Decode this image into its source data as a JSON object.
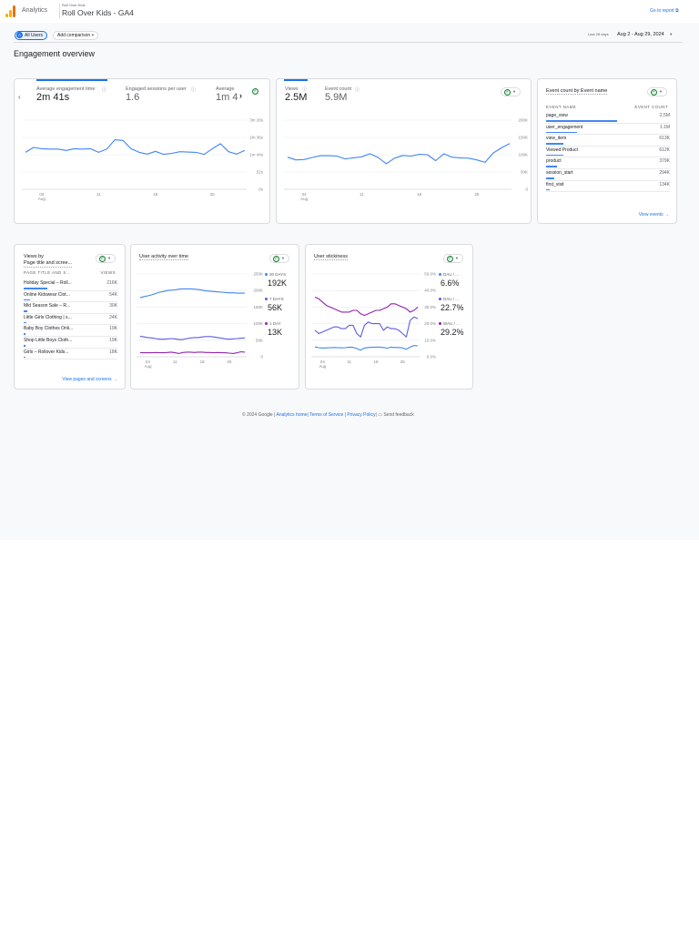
{
  "header": {
    "app_name": "Analytics",
    "account": "Roll Over Kids",
    "property": "Roll Over Kids - GA4",
    "go_to_report": "Go to report"
  },
  "toolbar": {
    "segment_letter": "A",
    "segment": "All Users",
    "add_comparison": "Add comparison",
    "add_icon": "+",
    "date_prefix": "Last 28 days",
    "date_range": "Aug 2 - Aug 29, 2024"
  },
  "page_title": "Engagement overview",
  "card1": {
    "metrics": [
      {
        "label": "Average engagement time",
        "value": "2m 41s"
      },
      {
        "label": "Engaged sessions per user",
        "value": "1.6"
      },
      {
        "label": "Average",
        "value": "1m 4"
      }
    ]
  },
  "card2": {
    "metrics": [
      {
        "label": "Views",
        "value": "2.5M"
      },
      {
        "label": "Event count",
        "value": "5.9M"
      }
    ]
  },
  "card3": {
    "title": "Event count by Event name",
    "col1": "EVENT NAME",
    "col2": "EVENT COUNT",
    "link": "View events",
    "rows": [
      {
        "name": "page_view",
        "value": "2.5M",
        "share": 1.0
      },
      {
        "name": "user_engagement",
        "value": "1.1M",
        "share": 0.44
      },
      {
        "name": "view_item",
        "value": "613K",
        "share": 0.25
      },
      {
        "name": "Viewed Product",
        "value": "612K",
        "share": 0.25
      },
      {
        "name": "product",
        "value": "379K",
        "share": 0.15
      },
      {
        "name": "session_start",
        "value": "294K",
        "share": 0.12
      },
      {
        "name": "first_visit",
        "value": "134K",
        "share": 0.05
      }
    ]
  },
  "card4": {
    "title_line1": "Views by",
    "title_line2": "Page title and scree...",
    "col1": "PAGE TITLE AND S...",
    "col2": "VIEWS",
    "link": "View pages and screens",
    "rows": [
      {
        "name": "Holiday Special – Roll...",
        "value": "216K",
        "share": 0.45
      },
      {
        "name": "Online Kidswear Clot...",
        "value": "54K",
        "share": 0.12
      },
      {
        "name": "Mid Season Sale – R...",
        "value": "30K",
        "share": 0.06
      },
      {
        "name": "Little Girls Clothing | s...",
        "value": "24K",
        "share": 0.05
      },
      {
        "name": "Baby Boy Clothes Onli...",
        "value": "19K",
        "share": 0.04
      },
      {
        "name": "Shop Little Boys Cloth...",
        "value": "19K",
        "share": 0.04
      },
      {
        "name": "Girls – Rollover Kids...",
        "value": "18K",
        "share": 0.04
      }
    ]
  },
  "card5": {
    "title": "User activity over time",
    "legend": [
      {
        "label": "30 DAYS",
        "value": "192K"
      },
      {
        "label": "7 DAYS",
        "value": "56K"
      },
      {
        "label": "1 DAY",
        "value": "13K"
      }
    ]
  },
  "card6": {
    "title": "User stickiness",
    "legend": [
      {
        "label": "DAU / ...",
        "value": "6.6%"
      },
      {
        "label": "DAU / ...",
        "value": "22.7%"
      },
      {
        "label": "WAU / ...",
        "value": "29.2%"
      }
    ]
  },
  "footer": {
    "copyright": "© 2024 Google |",
    "analytics_home": "Analytics home",
    "sep1": "|",
    "terms": "Terms of Service",
    "sep2": "|",
    "privacy": "Privacy Policy",
    "sep3": "|",
    "feedback": "Send feedback"
  },
  "colors": {
    "accent": "#1a73e8",
    "line1": "#4285f4",
    "line2": "#5c5ce6",
    "line3": "#8e24aa"
  },
  "chart_data": [
    {
      "type": "line",
      "title": "Average engagement time",
      "ylim": [
        0,
        208
      ],
      "yticks": [
        "0s",
        "52s",
        "1m 44s",
        "2m 36s",
        "3m 28s"
      ],
      "xticks": [
        "04",
        "11",
        "18",
        "25"
      ],
      "xtick_index": [
        2,
        9,
        16,
        23
      ],
      "xsub": "Aug",
      "series": [
        {
          "name": "Average engagement time (s)",
          "color": "#4285f4",
          "values": [
            111,
            126,
            122,
            121,
            121,
            117,
            122,
            121,
            122,
            111,
            121,
            149,
            147,
            122,
            111,
            106,
            114,
            105,
            108,
            113,
            112,
            111,
            105,
            122,
            137,
            113,
            106,
            117
          ]
        }
      ]
    },
    {
      "type": "line",
      "title": "Views",
      "ylim": [
        0,
        200
      ],
      "yticks": [
        "0",
        "50K",
        "100K",
        "150K",
        "200K"
      ],
      "xticks": [
        "04",
        "11",
        "18",
        "25"
      ],
      "xtick_index": [
        2,
        9,
        16,
        23
      ],
      "xsub": "Aug",
      "series": [
        {
          "name": "Views (K)",
          "color": "#4285f4",
          "values": [
            93,
            85,
            86,
            92,
            97,
            97,
            96,
            88,
            91,
            94,
            103,
            92,
            74,
            90,
            98,
            96,
            101,
            100,
            83,
            103,
            93,
            91,
            90,
            85,
            78,
            105,
            120,
            132
          ]
        }
      ]
    },
    {
      "type": "line",
      "title": "User activity over time",
      "ylim": [
        0,
        250
      ],
      "yticks": [
        "0",
        "50K",
        "100K",
        "150K",
        "200K",
        "250K"
      ],
      "xticks": [
        "04",
        "11",
        "18",
        "25"
      ],
      "xtick_index": [
        2,
        9,
        16,
        23
      ],
      "xsub": "Aug",
      "series": [
        {
          "name": "30 days (K)",
          "color": "#4285f4",
          "values": [
            178,
            182,
            184,
            187,
            191,
            195,
            197,
            200,
            201,
            202,
            204,
            205,
            205,
            205,
            204,
            203,
            201,
            199,
            198,
            197,
            196,
            195,
            194,
            193,
            193,
            192,
            192,
            192
          ]
        },
        {
          "name": "7 days (K)",
          "color": "#5c5ce6",
          "values": [
            62,
            60,
            58,
            57,
            55,
            53,
            53,
            54,
            55,
            54,
            52,
            52,
            55,
            57,
            58,
            58,
            60,
            61,
            61,
            60,
            58,
            56,
            54,
            53,
            54,
            55,
            56,
            57
          ]
        },
        {
          "name": "1 day (K)",
          "color": "#8e24aa",
          "values": [
            12,
            12,
            12,
            12,
            13,
            12,
            12,
            13,
            14,
            12,
            10,
            13,
            14,
            14,
            13,
            14,
            14,
            13,
            13,
            12,
            13,
            12,
            12,
            11,
            10,
            12,
            15,
            14
          ]
        }
      ]
    },
    {
      "type": "line",
      "title": "User stickiness",
      "ylim": [
        0,
        50
      ],
      "yticks": [
        "0.0%",
        "10.0%",
        "20.0%",
        "30.0%",
        "40.0%",
        "50.0%"
      ],
      "xticks": [
        "04",
        "11",
        "18",
        "25"
      ],
      "xtick_index": [
        2,
        9,
        16,
        23
      ],
      "xsub": "Aug",
      "series": [
        {
          "name": "WAU / MAU",
          "color": "#8e24aa",
          "values": [
            36,
            35,
            33,
            31,
            30,
            29,
            28,
            27,
            27,
            27,
            28,
            28,
            26,
            25,
            26,
            27,
            28,
            28,
            29,
            30,
            32,
            32,
            31,
            30,
            29,
            27,
            28,
            30
          ]
        },
        {
          "name": "DAU / WAU",
          "color": "#5c5ce6",
          "values": [
            16,
            14,
            15,
            16,
            17,
            18,
            18,
            17,
            17,
            19,
            19,
            14,
            12,
            19,
            21,
            20,
            20,
            20,
            16,
            18,
            17,
            17,
            16,
            14,
            12,
            22,
            24,
            23
          ]
        },
        {
          "name": "DAU / MAU",
          "color": "#4285f4",
          "values": [
            6,
            5.5,
            5.3,
            5.4,
            5.5,
            5.6,
            5.5,
            5.4,
            5.5,
            5.8,
            5.7,
            5,
            4,
            5.3,
            5.6,
            5.7,
            5.8,
            5.8,
            5.6,
            5.2,
            5.8,
            5.6,
            5.6,
            5.4,
            4.5,
            5.8,
            6.8,
            6.6
          ]
        }
      ]
    }
  ]
}
